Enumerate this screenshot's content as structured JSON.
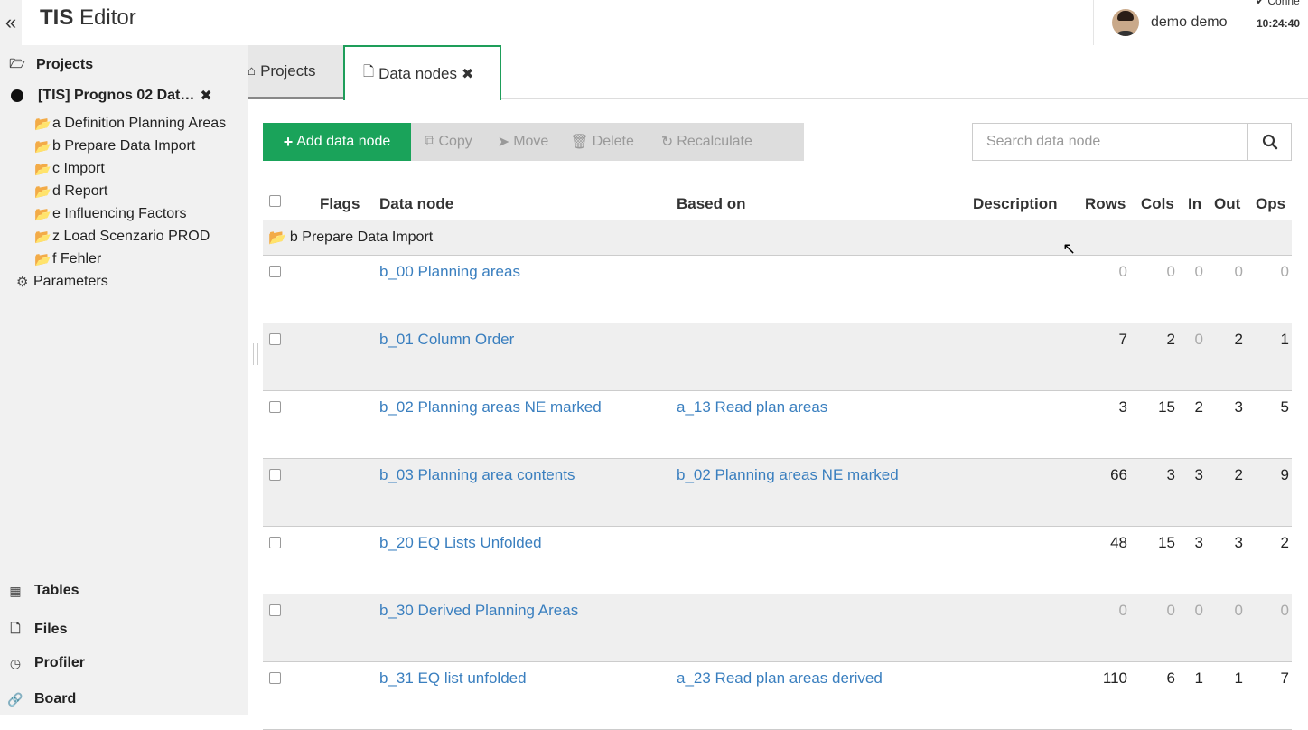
{
  "header": {
    "collapse_icon": "«",
    "title_bold": "TIS",
    "title_rest": " Editor",
    "user_name": "demo demo",
    "connection_text": "✔ Conne",
    "clock": "10:24:40"
  },
  "sidebar": {
    "projects_label": "Projects",
    "project_name": "[TIS] Prognos 02 Dat…",
    "close_glyph": "✖",
    "folders": [
      "a Definition Planning Areas",
      "b Prepare Data Import",
      "c Import",
      "d Report",
      "e Influencing Factors",
      "z Load Scenzario PROD",
      "f Fehler"
    ],
    "parameters_label": "Parameters",
    "bottom_items": [
      "Tables",
      "Files",
      "Profiler",
      "Board"
    ]
  },
  "tabs": [
    {
      "label": "Projects",
      "icon": "home-icon"
    },
    {
      "label": "Data nodes",
      "icon": "file-icon",
      "close": "✖"
    }
  ],
  "toolbar": {
    "add_label": "Add data node",
    "copy_label": "Copy",
    "move_label": "Move",
    "delete_label": "Delete",
    "recalc_label": "Recalculate"
  },
  "search": {
    "placeholder": "Search data node"
  },
  "table": {
    "columns": [
      "Flags",
      "Data node",
      "Based on",
      "Description",
      "Rows",
      "Cols",
      "In",
      "Out",
      "Ops"
    ],
    "group_label": "b Prepare Data Import",
    "rows": [
      {
        "node": "b_00 Planning areas",
        "based_on": "",
        "rows": "0",
        "cols": "0",
        "in": "0",
        "out": "0",
        "ops": "0"
      },
      {
        "node": "b_01 Column Order",
        "based_on": "",
        "rows": "7",
        "cols": "2",
        "in": "0",
        "out": "2",
        "ops": "1"
      },
      {
        "node": "b_02 Planning areas NE marked",
        "based_on": "a_13 Read plan areas",
        "rows": "3",
        "cols": "15",
        "in": "2",
        "out": "3",
        "ops": "5"
      },
      {
        "node": "b_03 Planning area contents",
        "based_on": "b_02 Planning areas NE marked",
        "rows": "66",
        "cols": "3",
        "in": "3",
        "out": "2",
        "ops": "9"
      },
      {
        "node": "b_20 EQ Lists Unfolded",
        "based_on": "",
        "rows": "48",
        "cols": "15",
        "in": "3",
        "out": "3",
        "ops": "2"
      },
      {
        "node": "b_30 Derived Planning Areas",
        "based_on": "",
        "rows": "0",
        "cols": "0",
        "in": "0",
        "out": "0",
        "ops": "0"
      },
      {
        "node": "b_31 EQ list unfolded",
        "based_on": "a_23 Read plan areas derived",
        "rows": "110",
        "cols": "6",
        "in": "1",
        "out": "1",
        "ops": "7"
      }
    ]
  }
}
